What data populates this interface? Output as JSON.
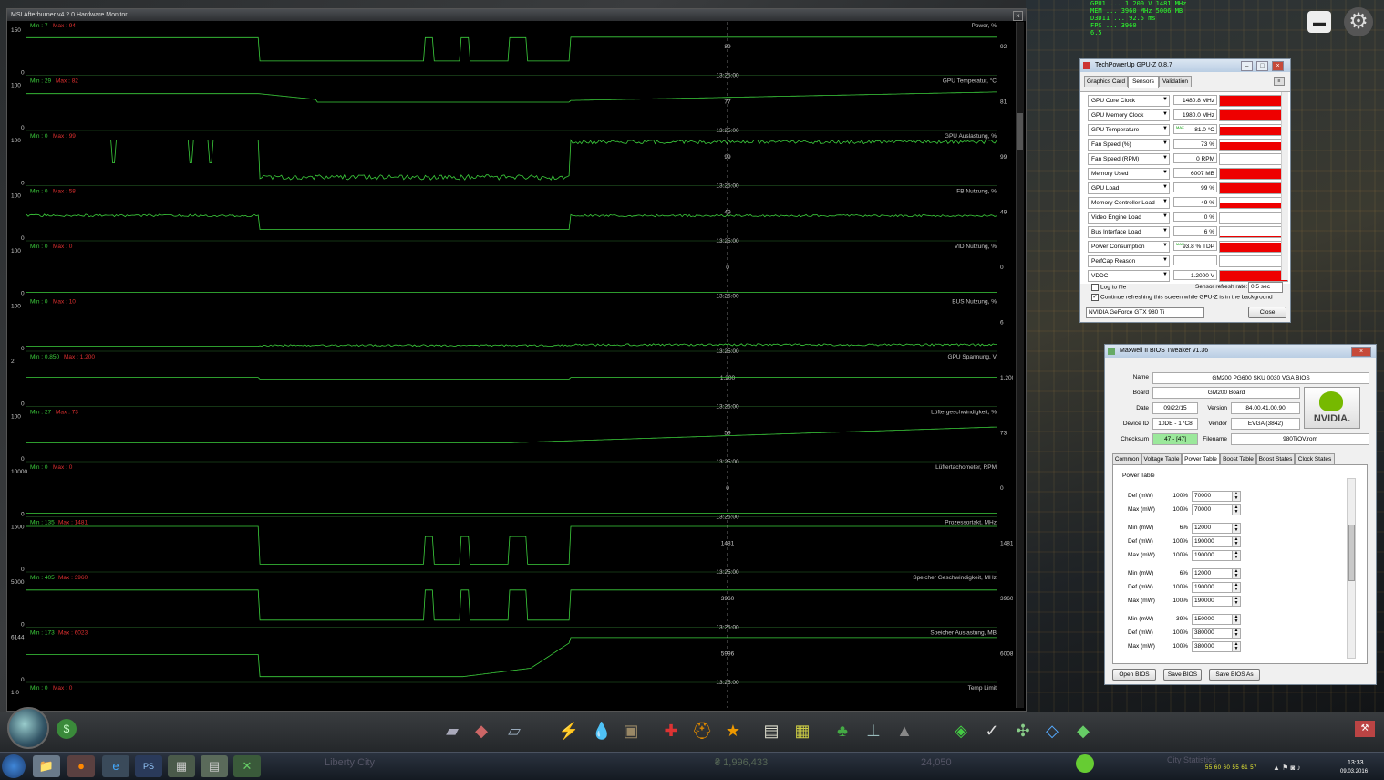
{
  "afterburner": {
    "title": "MSI Afterburner v4.2.0 Hardware Monitor",
    "close": "×",
    "graphs": [
      {
        "name": "Power, %",
        "min": "7",
        "max": "94",
        "axis_top": "150",
        "axis_bottom": "0",
        "cursor": "89",
        "right": "92",
        "time": "13:25:00"
      },
      {
        "name": "GPU Temperatur, °C",
        "min": "29",
        "max": "82",
        "axis_top": "100",
        "axis_bottom": "0",
        "cursor": "77",
        "right": "81",
        "time": "13:25:00"
      },
      {
        "name": "GPU Auslastung, %",
        "min": "0",
        "max": "99",
        "axis_top": "100",
        "axis_bottom": "0",
        "cursor": "99",
        "right": "99",
        "time": "13:25:00"
      },
      {
        "name": "FB Nutzung, %",
        "min": "0",
        "max": "58",
        "axis_top": "100",
        "axis_bottom": "0",
        "cursor": "49",
        "right": "49",
        "time": "13:25:00"
      },
      {
        "name": "VID Nutzung, %",
        "min": "0",
        "max": "0",
        "axis_top": "100",
        "axis_bottom": "0",
        "cursor": "0",
        "right": "0",
        "time": "13:25:00"
      },
      {
        "name": "BUS Nutzung, %",
        "min": "0",
        "max": "10",
        "axis_top": "100",
        "axis_bottom": "0",
        "cursor": "",
        "right": "6",
        "time": "13:25:00"
      },
      {
        "name": "GPU Spannung, V",
        "min": "0.850",
        "max": "1.200",
        "axis_top": "2",
        "axis_bottom": "0",
        "cursor": "1.200",
        "right": "1.200",
        "time": "13:25:00"
      },
      {
        "name": "Lüftergeschwindigkeit, %",
        "min": "27",
        "max": "73",
        "axis_top": "100",
        "axis_bottom": "0",
        "cursor": "59",
        "right": "73",
        "time": "13:25:00"
      },
      {
        "name": "Lüftertachometer, RPM",
        "min": "0",
        "max": "0",
        "axis_top": "10000",
        "axis_bottom": "0",
        "cursor": "0",
        "right": "0",
        "time": "13:25:00"
      },
      {
        "name": "Prozessortakt, MHz",
        "min": "135",
        "max": "1481",
        "axis_top": "1500",
        "axis_bottom": "0",
        "cursor": "1481",
        "right": "1481",
        "time": "13:25:00"
      },
      {
        "name": "Speicher Geschwindigkeit, MHz",
        "min": "405",
        "max": "3960",
        "axis_top": "5000",
        "axis_bottom": "0",
        "cursor": "3960",
        "right": "3960",
        "time": "13:25:00"
      },
      {
        "name": "Speicher Auslastung, MB",
        "min": "173",
        "max": "6023",
        "axis_top": "6144",
        "axis_bottom": "0",
        "cursor": "5996",
        "right": "6008",
        "time": "13:25:00"
      },
      {
        "name": "Temp Limit",
        "min": "0",
        "max": "0",
        "axis_top": "1.0",
        "axis_bottom": "",
        "cursor": "",
        "right": "",
        "time": ""
      }
    ],
    "min_label": "Min :",
    "max_label": "Max :",
    "colors": {
      "line": "#3ccf3c",
      "axis": "#2a6a2a",
      "text": "#c8c8c8",
      "minmax_min": "#3ccf3c",
      "minmax_max": "#e03030"
    }
  },
  "osd": {
    "lines": [
      "GPU1  ...  1.200 V  1481 MHz",
      "MEM   ...  3960 MHz  5006 MB",
      "D3D11  ...  92.5 ms",
      "FPS    ... 3960",
      "                  6.5"
    ]
  },
  "gpuz": {
    "title": "TechPowerUp GPU-Z 0.8.7",
    "tabs": [
      "Graphics Card",
      "Sensors",
      "Validation"
    ],
    "sensors": [
      {
        "label": "GPU Core Clock",
        "value": "1480.8 MHz",
        "fill": 0.98
      },
      {
        "label": "GPU Memory Clock",
        "value": "1980.0 MHz",
        "fill": 0.98
      },
      {
        "label": "GPU Temperature",
        "value": "81.0 °C",
        "fill": 0.8,
        "max": "MAX"
      },
      {
        "label": "Fan Speed (%)",
        "value": "73 %",
        "fill": 0.7
      },
      {
        "label": "Fan Speed (RPM)",
        "value": "0 RPM",
        "fill": 0
      },
      {
        "label": "Memory Used",
        "value": "6007 MB",
        "fill": 0.98
      },
      {
        "label": "GPU Load",
        "value": "99 %",
        "fill": 0.98
      },
      {
        "label": "Memory Controller Load",
        "value": "49 %",
        "fill": 0.5
      },
      {
        "label": "Video Engine Load",
        "value": "0 %",
        "fill": 0
      },
      {
        "label": "Bus Interface Load",
        "value": "6 %",
        "fill": 0.05
      },
      {
        "label": "Power Consumption",
        "value": "93.8 % TDP",
        "fill": 0.9,
        "max": "MAX"
      },
      {
        "label": "PerfCap Reason",
        "value": "",
        "fill": 0
      },
      {
        "label": "VDDC",
        "value": "1.2000 V",
        "fill": 0.98
      }
    ],
    "log_to_file": "Log to file",
    "refresh_label": "Sensor refresh rate:",
    "refresh_value": "0.5 sec",
    "continue_label": "Continue refreshing this screen while GPU-Z is in the background",
    "gpu_select": "NVIDIA GeForce GTX 980 Ti",
    "close_btn": "Close"
  },
  "bios": {
    "title": "Maxwell II BIOS Tweaker v1.36",
    "name_label": "Name",
    "name_value": "GM200 PG600 SKU 0030 VGA BIOS",
    "board_label": "Board",
    "board_value": "GM200 Board",
    "date_label": "Date",
    "date_value": "09/22/15",
    "version_label": "Version",
    "version_value": "84.00.41.00.90",
    "device_label": "Device ID",
    "device_value": "10DE - 17C8",
    "vendor_label": "Vendor",
    "vendor_value": "EVGA (3842)",
    "checksum_label": "Checksum",
    "checksum_value": "47 - [47]",
    "filename_label": "Filename",
    "filename_value": "980TiOV.rom",
    "logo": "NVIDIA.",
    "tabs": [
      "Common",
      "Voltage Table",
      "Power Table",
      "Boost Table",
      "Boost States",
      "Clock States"
    ],
    "group_label": "Power Table",
    "rows": [
      {
        "label": "Def (mW)",
        "pct": "100%",
        "value": "70000"
      },
      {
        "label": "Max (mW)",
        "pct": "100%",
        "value": "70000"
      },
      {
        "label": "Min (mW)",
        "pct": "6%",
        "value": "12000"
      },
      {
        "label": "Def (mW)",
        "pct": "100%",
        "value": "190000"
      },
      {
        "label": "Max (mW)",
        "pct": "100%",
        "value": "190000"
      },
      {
        "label": "Min (mW)",
        "pct": "6%",
        "value": "12000"
      },
      {
        "label": "Def (mW)",
        "pct": "100%",
        "value": "190000"
      },
      {
        "label": "Max (mW)",
        "pct": "100%",
        "value": "190000"
      },
      {
        "label": "Min (mW)",
        "pct": "39%",
        "value": "150000"
      },
      {
        "label": "Def (mW)",
        "pct": "100%",
        "value": "380000"
      },
      {
        "label": "Max (mW)",
        "pct": "100%",
        "value": "380000"
      }
    ],
    "open_btn": "Open BIOS",
    "save_btn": "Save BIOS",
    "saveas_btn": "Save BIOS As"
  },
  "taskbar": {
    "clock_time": "13:33",
    "clock_date": "09.03.2016",
    "tray_numbers": "55  60  60  55  61  57",
    "game_city": "Liberty City",
    "game_money": "₴ 1,996,433",
    "game_pop": "24,050",
    "game_city2": "City Statistics"
  }
}
